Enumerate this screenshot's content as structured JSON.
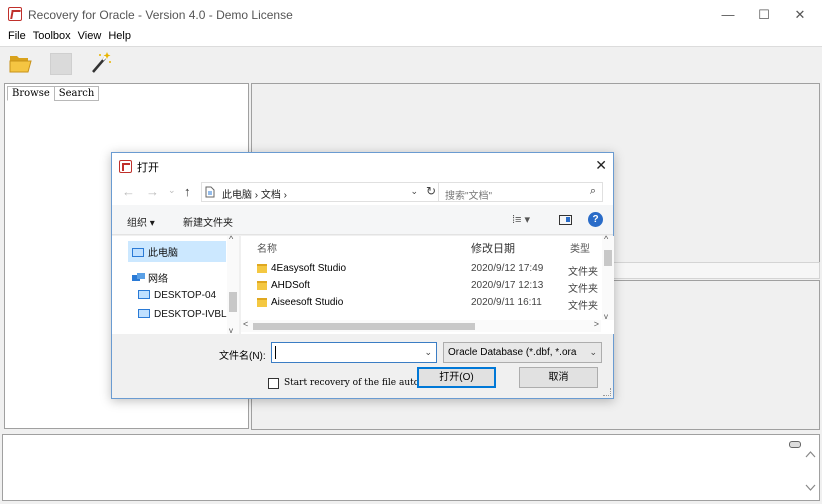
{
  "window": {
    "title": "Recovery for Oracle - Version 4.0 - Demo License",
    "minimize": "—",
    "maximize": "☐",
    "close": "✕"
  },
  "menu": [
    "File",
    "Toolbox",
    "View",
    "Help"
  ],
  "toolbar": {
    "open_icon": "folder-open-icon",
    "save_icon": "save-icon",
    "wizard_icon": "magic-wand-icon"
  },
  "left_tabs": [
    "Browse",
    "Search"
  ],
  "dialog": {
    "title": "打开",
    "close": "✕",
    "nav": {
      "back": "←",
      "forward": "→",
      "recent": "⌄",
      "up": "↑",
      "address": "此电脑 › 文档 ›",
      "address_drop": "⌄",
      "refresh": "↻"
    },
    "search_placeholder": "搜索\"文档\"",
    "search_icon": "⌕",
    "commands": {
      "organize": "组织 ▾",
      "new_folder": "新建文件夹",
      "view": "⁞≡ ▾",
      "help": "?"
    },
    "nav_pane": {
      "items": [
        "此电脑",
        "网络",
        "DESKTOP-04",
        "DESKTOP-IVBL"
      ]
    },
    "columns": [
      "名称",
      "修改日期",
      "类型"
    ],
    "files": [
      {
        "name": "4Easysoft Studio",
        "date": "2020/9/12 17:49",
        "type": "文件夹"
      },
      {
        "name": "AHDSoft",
        "date": "2020/9/17 12:13",
        "type": "文件夹"
      },
      {
        "name": "Aiseesoft Studio",
        "date": "2020/9/11 16:11",
        "type": "文件夹"
      }
    ],
    "filename_label": "文件名(N):",
    "filename_value": "",
    "filter_value": "Oracle Database (*.dbf, *.ora",
    "checkbox_label": "Start recovery of the file automa",
    "open_button": "打开(O)",
    "cancel_button": "取消"
  }
}
